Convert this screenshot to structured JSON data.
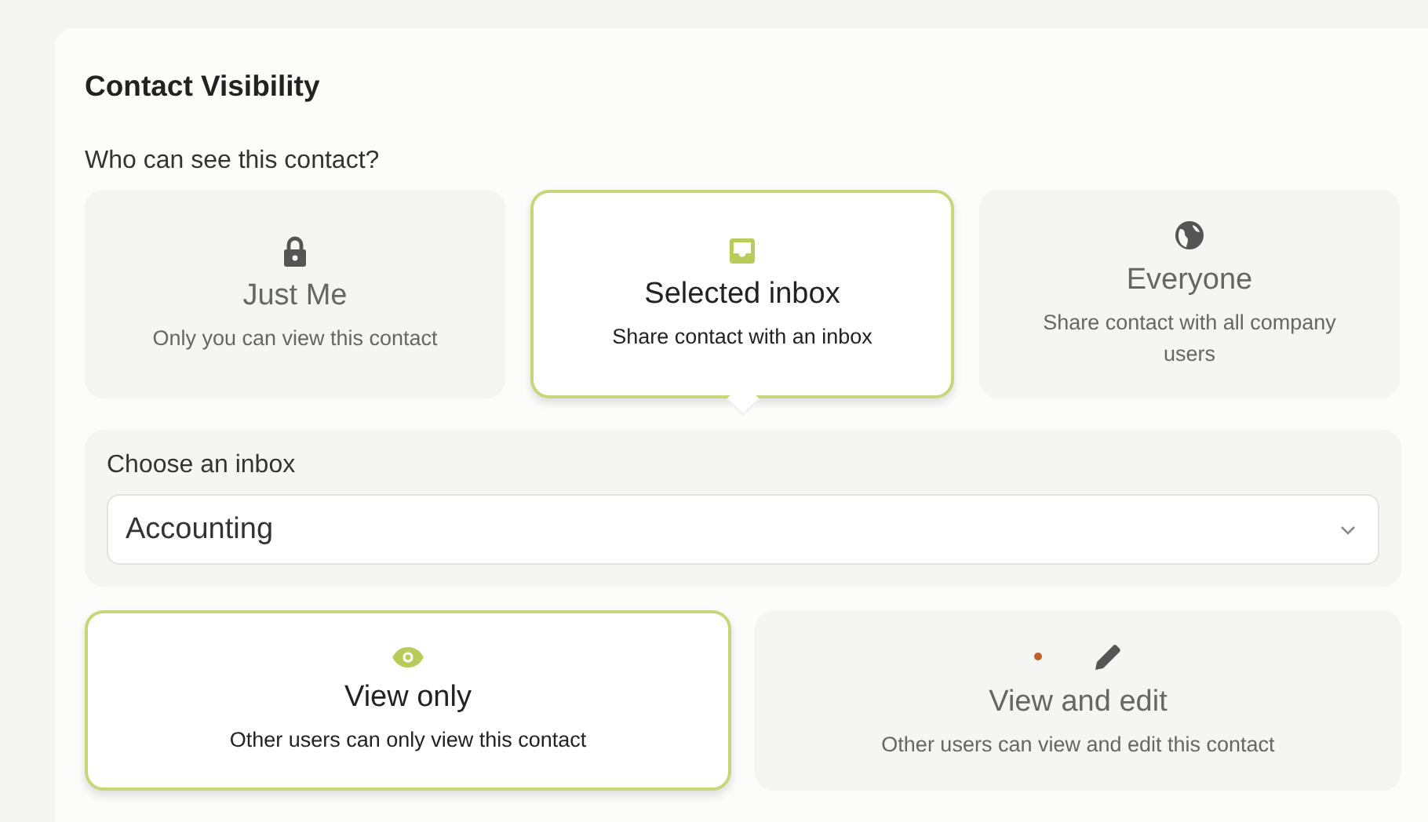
{
  "section": {
    "title": "Contact Visibility",
    "question": "Who can see this contact?"
  },
  "visibility_options": [
    {
      "kind": "private",
      "label": "Just Me",
      "description": "Only you can view this contact",
      "selected": false
    },
    {
      "kind": "inbox",
      "label": "Selected inbox",
      "description": "Share contact with an inbox",
      "selected": true
    },
    {
      "kind": "public",
      "label": "Everyone",
      "description": "Share contact with all company users",
      "selected": false
    }
  ],
  "inbox_select": {
    "label": "Choose an inbox",
    "value": "Accounting"
  },
  "permission_options": [
    {
      "kind": "view",
      "label": "View only",
      "description": "Other users can only view this contact",
      "selected": true
    },
    {
      "kind": "edit",
      "label": "View and edit",
      "description": "Other users can view and edit this contact",
      "selected": false
    }
  ]
}
